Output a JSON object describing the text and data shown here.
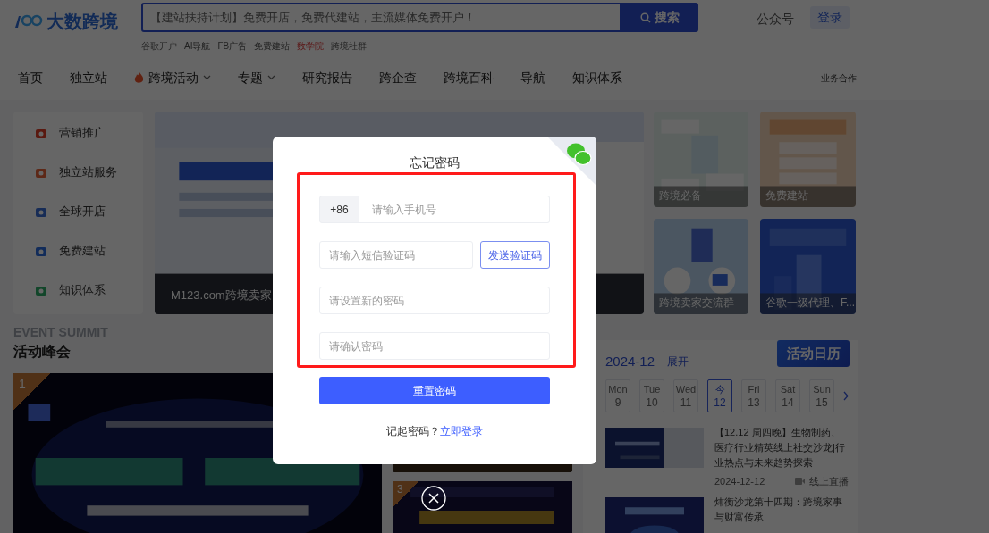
{
  "header": {
    "logo": "大数跨境",
    "search": {
      "placeholder": "【建站扶持计划】免费开店，免费代建站，主流媒体免费开户！",
      "button": "搜索"
    },
    "quick_links": [
      {
        "label": "谷歌开户",
        "highlighted": false
      },
      {
        "label": "AI导航",
        "highlighted": false
      },
      {
        "label": "FB广告",
        "highlighted": false
      },
      {
        "label": "免费建站",
        "highlighted": false
      },
      {
        "label": "数学院",
        "highlighted": true
      },
      {
        "label": "跨境社群",
        "highlighted": false
      }
    ],
    "account_link": "公众号",
    "login": "登录"
  },
  "nav": {
    "items": [
      {
        "label": "首页",
        "hot": false,
        "dropdown": false
      },
      {
        "label": "独立站",
        "hot": false,
        "dropdown": false
      },
      {
        "label": "跨境活动",
        "hot": true,
        "dropdown": true
      },
      {
        "label": "专题",
        "hot": false,
        "dropdown": true
      },
      {
        "label": "研究报告",
        "hot": false,
        "dropdown": false
      },
      {
        "label": "跨企查",
        "hot": false,
        "dropdown": false
      },
      {
        "label": "跨境百科",
        "hot": false,
        "dropdown": false
      },
      {
        "label": "导航",
        "hot": false,
        "dropdown": false
      },
      {
        "label": "知识体系",
        "hot": false,
        "dropdown": false
      }
    ],
    "right_link": "业务合作"
  },
  "sidebar": {
    "items": [
      {
        "label": "营销推广"
      },
      {
        "label": "独立站服务"
      },
      {
        "label": "全球开店"
      },
      {
        "label": "免费建站"
      },
      {
        "label": "知识体系"
      }
    ]
  },
  "banner": {
    "caption": "M123.com跨境卖家"
  },
  "cards": [
    {
      "caption": "跨境必备"
    },
    {
      "caption": "免费建站"
    },
    {
      "caption": "跨境卖家交流群"
    },
    {
      "caption": "谷歌一级代理、F..."
    }
  ],
  "events": {
    "title": "活动峰会",
    "subtitle": "EVENT SUMMIT",
    "featured": {
      "rank": "1"
    },
    "list": [
      {
        "rank": "3"
      }
    ]
  },
  "calendar": {
    "month": "2024-12",
    "expand": "展开",
    "button": "活动日历",
    "days": [
      {
        "weekday": "Mon",
        "date": "9",
        "selected": false
      },
      {
        "weekday": "Tue",
        "date": "10",
        "selected": false
      },
      {
        "weekday": "Wed",
        "date": "11",
        "selected": false
      },
      {
        "weekday": "今",
        "date": "12",
        "selected": true
      },
      {
        "weekday": "Fri",
        "date": "13",
        "selected": false
      },
      {
        "weekday": "Sat",
        "date": "14",
        "selected": false
      },
      {
        "weekday": "Sun",
        "date": "15",
        "selected": false
      }
    ],
    "entries": [
      {
        "title": "【12.12 周四晚】生物制药、医疗行业精英线上社交沙龙|行业热点与未来趋势探索",
        "date": "2024-12-12",
        "mode": "线上直播"
      },
      {
        "title": "炜衡沙龙第十四期：跨境家事与财富传承"
      }
    ]
  },
  "dialog": {
    "title": "忘记密码",
    "fields": [
      {
        "kind": "phone",
        "prefix": "+86",
        "placeholder": "请输入手机号"
      },
      {
        "kind": "code",
        "placeholder": "请输入短信验证码",
        "button": "发送验证码"
      },
      {
        "kind": "password",
        "placeholder": "请设置新的密码"
      },
      {
        "kind": "password",
        "placeholder": "请确认密码"
      }
    ],
    "submit": "重置密码",
    "footer": {
      "text": "记起密码？",
      "link": "立即登录"
    }
  }
}
